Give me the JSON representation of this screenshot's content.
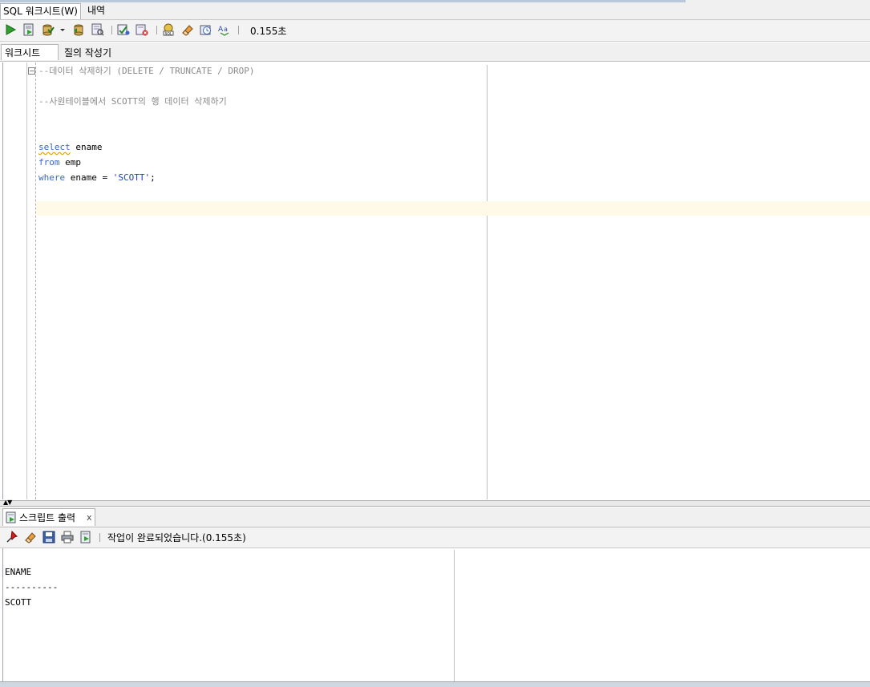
{
  "window": {
    "tabs": [
      {
        "label": "SQL 워크시트(W)",
        "active": true
      },
      {
        "label": "내역",
        "active": false
      }
    ]
  },
  "toolbar": {
    "icons": [
      "run-statement-icon",
      "run-script-icon",
      "commit-icon",
      "dropdown-arrow-icon",
      "rollback-icon",
      "explain-plan-icon",
      "autotrace-icon",
      "clear-icon",
      "sql-tuning-icon",
      "eraser-icon",
      "history-icon",
      "format-case-icon"
    ],
    "timing": "0.155초"
  },
  "sub_tabs": [
    {
      "label": "워크시트",
      "active": true
    },
    {
      "label": "질의 작성기",
      "active": false
    }
  ],
  "editor": {
    "lines": {
      "comment1": "--데이터 삭제하기 (DELETE / TRUNCATE / DROP)",
      "comment2": "--사원테이블에서 SCOTT의 행 데이터 삭제하기",
      "select_kw": "select",
      "select_rest": " ename",
      "from_kw": "from",
      "from_rest": " emp",
      "where_kw": "where",
      "where_mid": " ename = ",
      "where_str": "'SCOTT'",
      "where_end": ";"
    }
  },
  "output_panel": {
    "tab_label": "스크립트 출력",
    "close": "x",
    "icons": [
      "pin-icon",
      "eraser-icon",
      "save-icon",
      "print-icon",
      "open-file-icon"
    ],
    "status": "작업이 완료되었습니다.(0.155초)",
    "result": {
      "header": "ENAME",
      "underline": "----------",
      "row1": "SCOTT"
    }
  },
  "colors": {
    "keyword": "#3a66c8",
    "string": "#1d44b8",
    "comment": "#8a8a8a",
    "current_line": "#fffae8"
  }
}
